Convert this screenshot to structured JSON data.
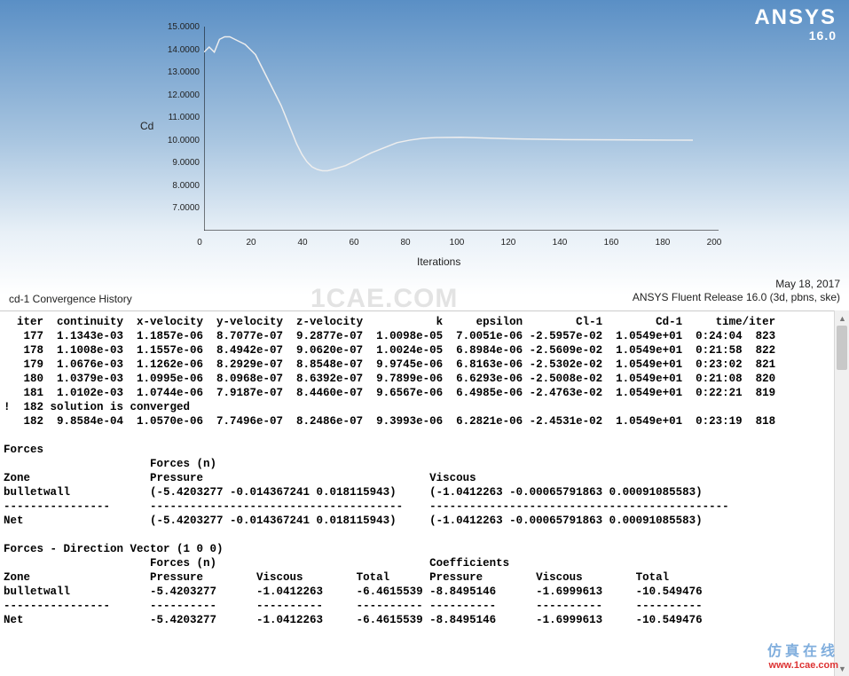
{
  "brand": {
    "name": "ANSYS",
    "version": "16.0"
  },
  "chart_data": {
    "type": "line",
    "title": "",
    "xlabel": "Iterations",
    "ylabel": "Cd",
    "xlim": [
      0,
      200
    ],
    "ylim": [
      7.0,
      15.0
    ],
    "xticks": [
      0,
      20,
      40,
      60,
      80,
      100,
      120,
      140,
      160,
      180,
      200
    ],
    "yticks": [
      "15.0000",
      "14.0000",
      "13.0000",
      "12.0000",
      "11.0000",
      "10.0000",
      "9.0000",
      "8.0000",
      "7.0000"
    ],
    "x": [
      0,
      2,
      4,
      6,
      8,
      10,
      12,
      14,
      16,
      18,
      20,
      22,
      24,
      26,
      28,
      30,
      32,
      34,
      36,
      38,
      40,
      42,
      44,
      46,
      48,
      50,
      55,
      60,
      65,
      70,
      75,
      80,
      85,
      90,
      100,
      110,
      120,
      140,
      160,
      180,
      190
    ],
    "values": [
      14.0,
      14.2,
      14.0,
      14.5,
      14.6,
      14.6,
      14.5,
      14.4,
      14.3,
      14.1,
      13.9,
      13.5,
      13.1,
      12.7,
      12.3,
      11.9,
      11.4,
      10.9,
      10.4,
      10.0,
      9.7,
      9.5,
      9.4,
      9.35,
      9.35,
      9.4,
      9.55,
      9.8,
      10.05,
      10.25,
      10.45,
      10.55,
      10.62,
      10.65,
      10.66,
      10.63,
      10.6,
      10.57,
      10.56,
      10.55,
      10.55
    ]
  },
  "caption": {
    "left": "cd-1 Convergence History",
    "date": "May 18, 2017",
    "release": "ANSYS Fluent Release 16.0 (3d, pbns, ske)"
  },
  "watermark_mid": "1CAE.COM",
  "watermark_bottom": {
    "line1": "仿真在线",
    "line2": "www.1cae.com"
  },
  "console": {
    "header": "  iter  continuity  x-velocity  y-velocity  z-velocity           k     epsilon        Cl-1        Cd-1     time/iter",
    "rows": [
      "   177  1.1343e-03  1.1857e-06  8.7077e-07  9.2877e-07  1.0098e-05  7.0051e-06 -2.5957e-02  1.0549e+01  0:24:04  823",
      "   178  1.1008e-03  1.1557e-06  8.4942e-07  9.0620e-07  1.0024e-05  6.8984e-06 -2.5609e-02  1.0549e+01  0:21:58  822",
      "   179  1.0676e-03  1.1262e-06  8.2929e-07  8.8548e-07  9.9745e-06  6.8163e-06 -2.5302e-02  1.0549e+01  0:23:02  821",
      "   180  1.0379e-03  1.0995e-06  8.0968e-07  8.6392e-07  9.7899e-06  6.6293e-06 -2.5008e-02  1.0549e+01  0:21:08  820",
      "   181  1.0102e-03  1.0744e-06  7.9187e-07  8.4460e-07  9.6567e-06  6.4985e-06 -2.4763e-02  1.0549e+01  0:22:21  819"
    ],
    "converged": "!  182 solution is converged",
    "row_last": "   182  9.8584e-04  1.0570e-06  7.7496e-07  8.2486e-07  9.3993e-06  6.2821e-06 -2.4531e-02  1.0549e+01  0:23:19  818",
    "blank": "",
    "forces_title": "Forces",
    "forces_hdr1": "                      Forces (n)",
    "forces_hdr2": "Zone                  Pressure                                  Viscous",
    "forces_row": "bulletwall            (-5.4203277 -0.014367241 0.018115943)     (-1.0412263 -0.00065791863 0.00091085583)",
    "dash1": "----------------      --------------------------------------    ---------------------------------------------",
    "forces_net": "Net                   (-5.4203277 -0.014367241 0.018115943)     (-1.0412263 -0.00065791863 0.00091085583)",
    "dir_title": "Forces - Direction Vector (1 0 0)",
    "dir_hdr1": "                      Forces (n)                                Coefficients",
    "dir_hdr2": "Zone                  Pressure        Viscous        Total      Pressure        Viscous        Total",
    "dir_row": "bulletwall            -5.4203277      -1.0412263     -6.4615539 -8.8495146      -1.6999613     -10.549476",
    "dash2": "----------------      ----------      ----------     ---------- ----------      ----------     ----------",
    "dir_net": "Net                   -5.4203277      -1.0412263     -6.4615539 -8.8495146      -1.6999613     -10.549476"
  }
}
